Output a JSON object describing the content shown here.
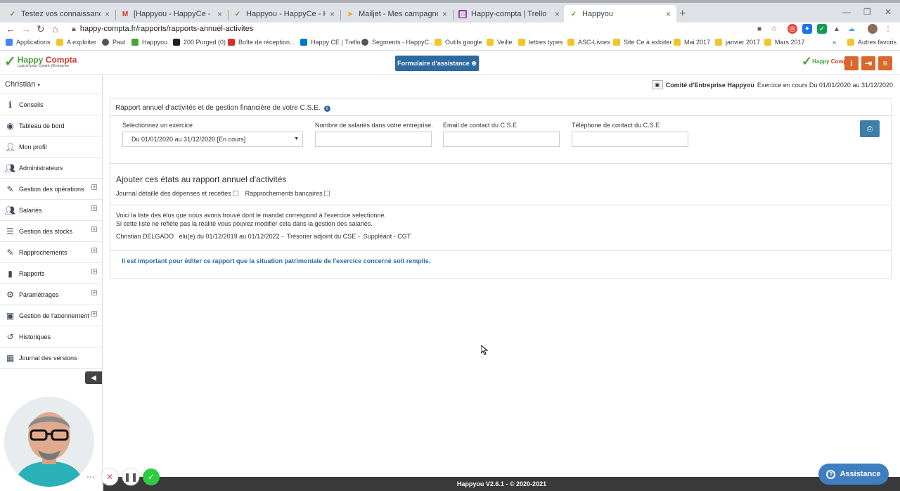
{
  "browser": {
    "tabs": [
      {
        "title": "Testez vos connaissances des re",
        "icon": "happy-compta-favicon"
      },
      {
        "title": "[Happyou - HappyCe - Happy-C",
        "icon": "gmail-icon"
      },
      {
        "title": "Happyou - HappyCe - Happy-Co",
        "icon": "happy-compta-favicon"
      },
      {
        "title": "Mailjet - Mes campagnes",
        "icon": "mailjet-icon"
      },
      {
        "title": "Happy-compta | Trello",
        "icon": "trello-icon"
      },
      {
        "title": "Happyou",
        "icon": "happy-compta-favicon"
      }
    ],
    "url": "happy-compta.fr/rapports/rapports-annuel-activites",
    "bookmarks": [
      "Applications",
      "A exploiter",
      "Paul",
      "Happyou",
      "200 Purged (0)",
      "Boîte de réception...",
      "Happy CE | Trello",
      "Segments - HappyC...",
      "Outils google",
      "Veille",
      "lettres types",
      "ASC-Livres",
      "Site Ce à exloiter",
      "Mai 2017",
      "janvier 2017",
      "Mars 2017"
    ],
    "other_bookmarks": "Autres favoris"
  },
  "header": {
    "logo_main": "Happy",
    "logo_accent": "Compta",
    "logo_sub": "Logiciel pour Comité d'Entreprise",
    "assist_button": "Formulaire d'assistance"
  },
  "sidebar": {
    "user": "Christian",
    "items": [
      {
        "label": "Conseils",
        "icon": "info-icon",
        "expand": false
      },
      {
        "label": "Tableau de bord",
        "icon": "dashboard-icon",
        "expand": false
      },
      {
        "label": "Mon profil",
        "icon": "user-icon",
        "expand": false
      },
      {
        "label": "Administrateurs",
        "icon": "users-icon",
        "expand": false
      },
      {
        "label": "Gestion des opérations",
        "icon": "edit-icon",
        "expand": true
      },
      {
        "label": "Salariés",
        "icon": "users-icon",
        "expand": true
      },
      {
        "label": "Gestion des stocks",
        "icon": "database-icon",
        "expand": true
      },
      {
        "label": "Rapprochements",
        "icon": "edit-icon",
        "expand": true
      },
      {
        "label": "Rapports",
        "icon": "file-icon",
        "expand": true
      },
      {
        "label": "Paramétrages",
        "icon": "gear-icon",
        "expand": true
      },
      {
        "label": "Gestion de l'abonnement",
        "icon": "money-icon",
        "expand": true
      },
      {
        "label": "Historiques",
        "icon": "history-icon",
        "expand": false
      },
      {
        "label": "Journal des versions",
        "icon": "calendar-icon",
        "expand": false
      }
    ]
  },
  "topinfo": {
    "committee": "Comité d'Entreprise Happyou",
    "period": "Exercice en cours Du 01/01/2020 au 31/12/2020"
  },
  "report": {
    "title": "Rapport annuel d'activités et de gestion financière de votre C.S.E.",
    "fields": {
      "exercise_label": "Selectionnez un exercice",
      "exercise_value": "Du 01/01/2020 au 31/12/2020 [En cours]",
      "employees_label": "Nombre de salariés dans votre entreprise.",
      "employees_value": "",
      "email_label": "Email de contact du C.S.E",
      "email_value": "",
      "phone_label": "Téléphone de contact du C.S.E",
      "phone_value": ""
    },
    "add_states_title": "Ajouter ces états au rapport annuel d'activités",
    "checkbox_journal": "Journal détaillé des dépenses et recettes",
    "checkbox_rapprochements": "Rapprochements bancaires",
    "elus_line1": "Voici la liste des élus que nous avons trouvé dont le mandat correspond à l'exercice selectionné.",
    "elus_line2": "Si cette liste ne reflète pas la réalité vous pouvez modifier cela dans la gestion des salariés.",
    "elu_entry": "Christian DELGADO   élu(e) du 01/12/2019 au 01/12/2022 -  Trésorier adjoint du CSE -  Suppléant - CGT",
    "warning": "Il est important pour éditer ce rapport que la situation patrimoniale de l'exercice concerné soit remplis."
  },
  "footer": {
    "text": "Happyou V2.6.1 - © 2020-2021"
  },
  "help_button": "Assistance"
}
